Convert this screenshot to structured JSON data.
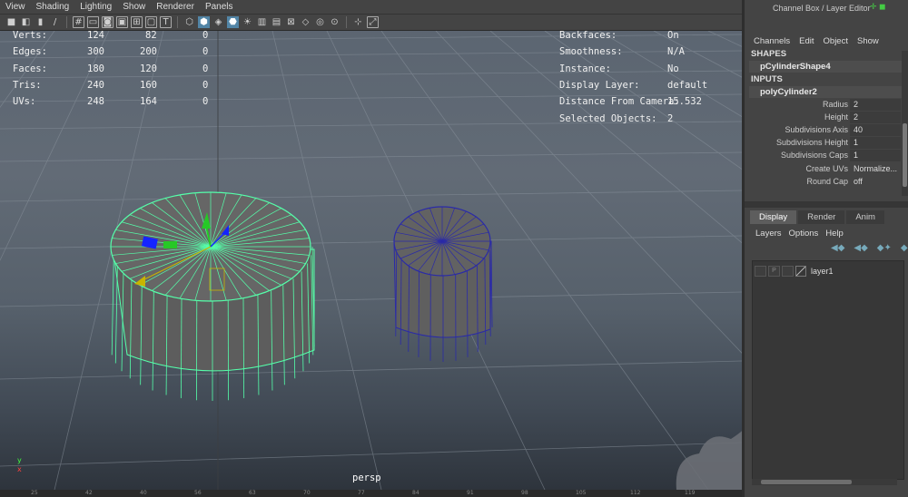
{
  "menubar": [
    "View",
    "Shading",
    "Lighting",
    "Show",
    "Renderer",
    "Panels"
  ],
  "toolbar_icons": [
    "camera-icon",
    "camera-attr-icon",
    "bookmark-icon",
    "brush-icon",
    "grid-icon",
    "film-gate-icon",
    "resolution-gate-icon",
    "gate-mask-icon",
    "field-chart-icon",
    "safe-action-icon",
    "safe-title-icon",
    "wireframe-cube-icon",
    "smooth-shade-icon",
    "wireframe-on-shaded-icon",
    "lighting-icon",
    "shadows-icon",
    "texture-icon",
    "isolate-select-icon",
    "xray-icon",
    "xray-joints-icon",
    "backface-icon",
    "resolve-icon",
    "camera-grid-icon",
    "frame-all-icon"
  ],
  "hud_left": {
    "rows": [
      {
        "label": "Verts:",
        "v1": "124",
        "v2": "82",
        "v3": "0"
      },
      {
        "label": "Edges:",
        "v1": "300",
        "v2": "200",
        "v3": "0"
      },
      {
        "label": "Faces:",
        "v1": "180",
        "v2": "120",
        "v3": "0"
      },
      {
        "label": "Tris:",
        "v1": "240",
        "v2": "160",
        "v3": "0"
      },
      {
        "label": "UVs:",
        "v1": "248",
        "v2": "164",
        "v3": "0"
      }
    ]
  },
  "hud_right": {
    "rows": [
      {
        "label": "Backfaces:",
        "value": "On"
      },
      {
        "label": "Smoothness:",
        "value": "N/A"
      },
      {
        "label": "Instance:",
        "value": "No"
      },
      {
        "label": "Display Layer:",
        "value": "default"
      },
      {
        "label": "Distance From Camera:",
        "value": "15.532"
      },
      {
        "label": "Selected Objects:",
        "value": "2"
      }
    ]
  },
  "viewport": {
    "camera_label": "persp",
    "axis_x": "x",
    "axis_y": "y"
  },
  "timeline": [
    "25",
    "42",
    "40",
    "56",
    "63",
    "70",
    "77",
    "84",
    "91",
    "98",
    "105",
    "112",
    "119"
  ],
  "panel": {
    "title": "Channel Box / Layer Editor",
    "menu": [
      "Channels",
      "Edit",
      "Object",
      "Show"
    ],
    "shapes_header": "SHAPES",
    "shape_node": "pCylinderShape4",
    "inputs_header": "INPUTS",
    "input_node": "polyCylinder2",
    "attributes": [
      {
        "label": "Radius",
        "value": "2"
      },
      {
        "label": "Height",
        "value": "2"
      },
      {
        "label": "Subdivisions Axis",
        "value": "40"
      },
      {
        "label": "Subdivisions Height",
        "value": "1"
      },
      {
        "label": "Subdivisions Caps",
        "value": "1"
      },
      {
        "label": "Create UVs",
        "value": "Normalize..."
      },
      {
        "label": "Round Cap",
        "value": "off"
      }
    ]
  },
  "layer_editor": {
    "tabs": [
      "Display",
      "Render",
      "Anim"
    ],
    "active_tab": "Display",
    "menu": [
      "Layers",
      "Options",
      "Help"
    ],
    "icons": [
      "move-layer-up-icon",
      "move-layer-down-icon",
      "new-layer-icon",
      "new-layer-selected-icon"
    ],
    "layers": [
      {
        "name": "layer1"
      }
    ]
  },
  "colors": {
    "selection_green": "#55ffaa",
    "wire_blue": "#2a2aa8",
    "active_tab": "#5285a6"
  }
}
